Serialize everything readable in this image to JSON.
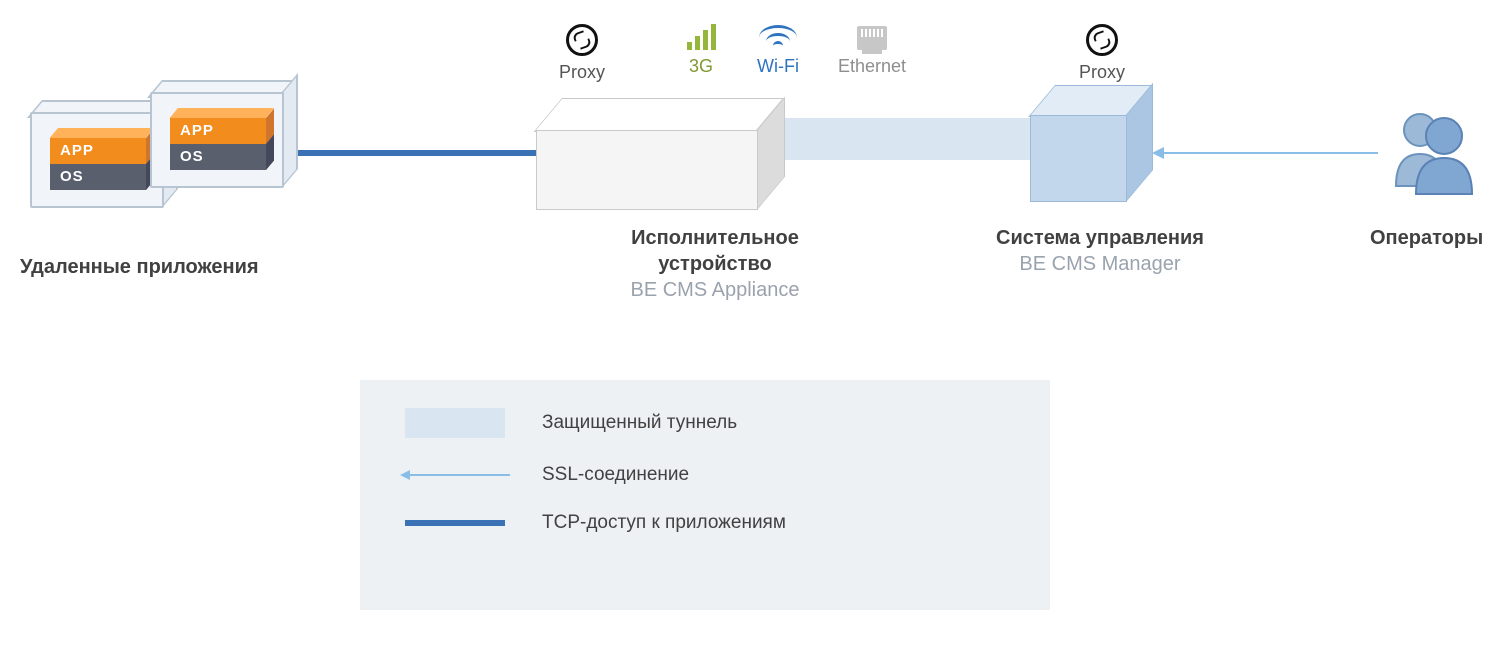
{
  "icons": {
    "proxy": "Proxy",
    "g3": "3G",
    "wifi": "Wi-Fi",
    "ethernet": "Ethernet"
  },
  "nodes": {
    "remote_apps": {
      "title": "Удаленные приложения",
      "app_label": "APP",
      "os_label": "OS"
    },
    "appliance": {
      "title_l1": "Исполнительное",
      "title_l2": "устройство",
      "subtitle": "BE CMS Appliance"
    },
    "manager": {
      "title": "Система управления",
      "subtitle": "BE CMS Manager"
    },
    "operators": {
      "title": "Операторы"
    }
  },
  "legend": {
    "tunnel": "Защищенный туннель",
    "ssl": "SSL-соединение",
    "tcp": "TCP-доступ к приложениям"
  }
}
